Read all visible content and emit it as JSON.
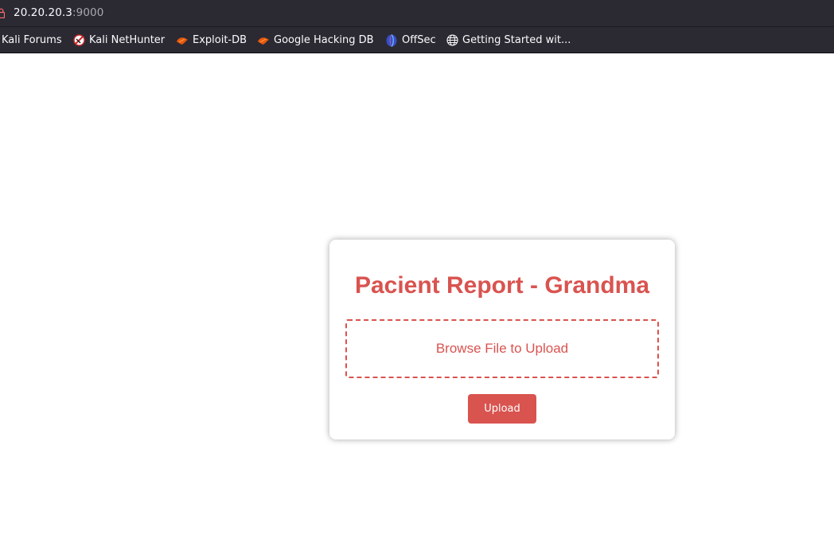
{
  "browser": {
    "url_host": "20.20.20.3",
    "url_port": ":9000",
    "bookmarks": [
      {
        "label": "Kali Forums",
        "icon": "none"
      },
      {
        "label": "Kali NetHunter",
        "icon": "nethunter-icon"
      },
      {
        "label": "Exploit-DB",
        "icon": "exploit-db-icon"
      },
      {
        "label": "Google Hacking DB",
        "icon": "exploit-db-icon"
      },
      {
        "label": "OffSec",
        "icon": "offsec-icon"
      },
      {
        "label": "Getting Started wit...",
        "icon": "globe-icon"
      }
    ]
  },
  "page": {
    "title": "Pacient Report - Grandma",
    "dropzone_label": "Browse File to Upload",
    "upload_label": "Upload",
    "accent_color": "#d9534f"
  }
}
